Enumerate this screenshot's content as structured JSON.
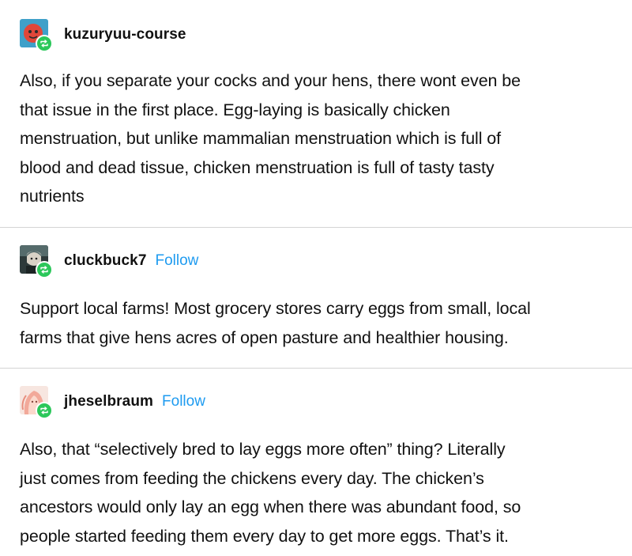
{
  "posts": [
    {
      "username": "kuzuryuu-course",
      "follow_label": "",
      "body_lines": [
        "Also, if you separate your cocks and your hens, there wont even be",
        "that issue in the first place. Egg-laying is basically chicken",
        "menstruation, but unlike mammalian menstruation which is full of",
        "blood and dead tissue, chicken menstruation is full of tasty tasty",
        "nutrients"
      ]
    },
    {
      "username": "cluckbuck7",
      "follow_label": "Follow",
      "body_lines": [
        "Support local farms! Most grocery stores carry eggs from small, local",
        "farms that give hens acres of open pasture and healthier housing."
      ]
    },
    {
      "username": "jheselbraum",
      "follow_label": "Follow",
      "body_lines": [
        "Also, that “selectively bred to lay eggs more often” thing? Literally",
        "just comes from feeding the chickens every day. The chicken’s",
        "ancestors would only lay an egg when there was abundant food, so",
        "people started feeding them every day to get more eggs. That’s it."
      ]
    }
  ],
  "colors": {
    "follow": "#1e9bf0",
    "reblog_badge": "#2bc75a",
    "divider": "#d4d4d4"
  },
  "icons": [
    "reblog-icon",
    "avatar"
  ]
}
